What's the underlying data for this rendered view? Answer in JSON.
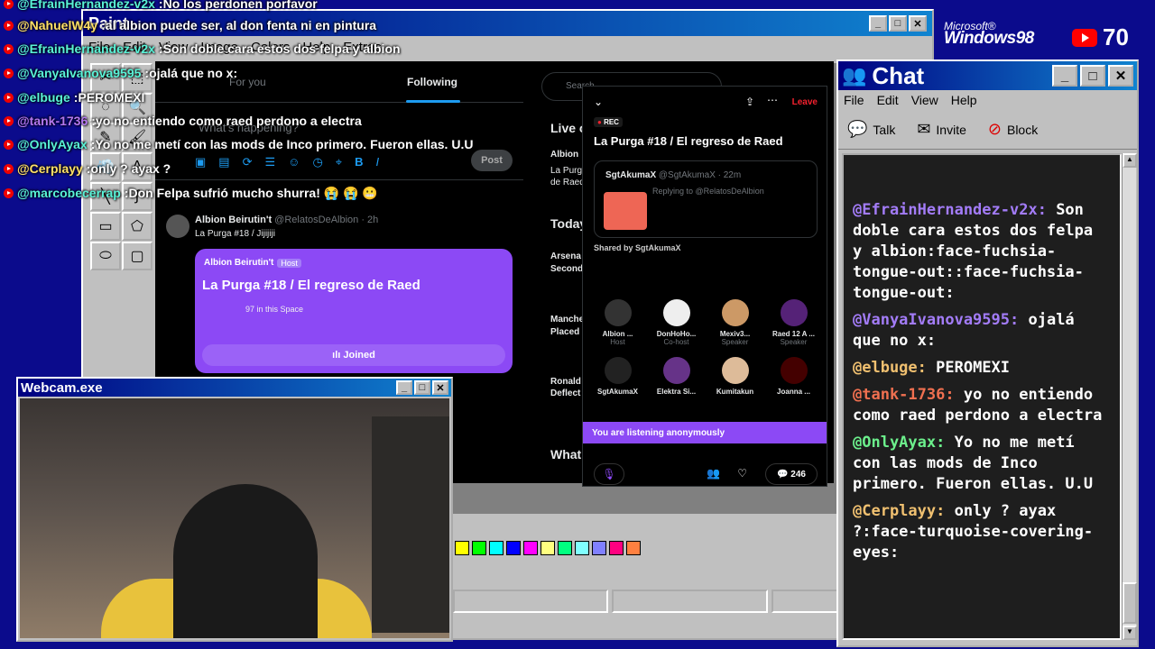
{
  "overlay_chat": [
    {
      "user": "@EfrainHernandez-v2x",
      "user_color": "#59f3d7",
      "message": "No los perdonen porfavor",
      "badge": ""
    },
    {
      "user": "@NahuelW4y",
      "user_color": "#ffe066",
      "message": "al albion puede ser, al don fenta ni en pintura",
      "badge": ""
    },
    {
      "user": "@EfrainHernandez-v2x",
      "user_color": "#59f3d7",
      "message": "Son doble cara estos dos felpa y albion",
      "badge": ""
    },
    {
      "user": "@VanyaIvanova9595",
      "user_color": "#59f3d7",
      "message": "ojalá que no x:",
      "badge": ""
    },
    {
      "user": "@elbuge",
      "user_color": "#59f3d7",
      "message": "PEROMEXI",
      "badge": ""
    },
    {
      "user": "@tank-1736",
      "user_color": "#b478f0",
      "message": "yo no entiendo como raed perdono a electra",
      "badge": ""
    },
    {
      "user": "@OnlyAyax",
      "user_color": "#59f3d7",
      "message": "Yo no me metí con las mods de Inco primero. Fueron ellas. U.U",
      "badge": "🔧"
    },
    {
      "user": "@Cerplayy",
      "user_color": "#ffe066",
      "message": "only ? ayax ?",
      "badge": ""
    },
    {
      "user": "@marcobecerrap",
      "user_color": "#59f3d7",
      "message": "Don Felpa sufrió mucho shurra! 😭 😭 😬",
      "badge": ""
    }
  ],
  "logos": {
    "ms_label": "Microsoft®",
    "windows_label": "Windows98",
    "viewer_count": "70"
  },
  "paint": {
    "title": "Paint",
    "menu": [
      "File",
      "Edit",
      "View",
      "Image",
      "Colors",
      "Help",
      "Extras"
    ],
    "tools": [
      "✂",
      "⬚",
      "◌",
      "🔍",
      "✎",
      "🖌",
      "💨",
      "A",
      "╲",
      "∫",
      "▭",
      "⬠",
      "⬭",
      "▢"
    ],
    "palette": [
      "#ffff00",
      "#00ff00",
      "#00ffff",
      "#0000ff",
      "#ff00ff",
      "#ffff80",
      "#00ff80",
      "#80ffff",
      "#8080ff",
      "#ff0080",
      "#ff8040"
    ]
  },
  "twitter": {
    "tab_for_you": "For you",
    "tab_following": "Following",
    "compose_placeholder": "What's happening?",
    "post_label": "Post",
    "search_placeholder": "Search",
    "tweet_author": "Albion Beirutin't",
    "tweet_handle": "@RelatosDeAlbion · 2h",
    "tweet_text": "La Purga #18 / Jijijiji",
    "space_host": "Albion Beirutin't",
    "host_badge": "Host",
    "space_title": "La Purga #18 / El regreso de Raed",
    "space_count": "97 in this Space",
    "joined_label": "Joined",
    "sidebar_live": "Live o",
    "sidebar_live_sub": "Albion",
    "sidebar_live_sub2": "La Purg",
    "sidebar_live_sub3": "de Raed",
    "sidebar_today": "Today",
    "sidebar_item1": "Arsena",
    "sidebar_item1b": "Second",
    "sidebar_item2": "Manche",
    "sidebar_item2b": "Placed",
    "sidebar_item3": "Ronald",
    "sidebar_item3b": "Deflect",
    "sidebar_whats": "What"
  },
  "spaces_panel": {
    "leave_label": "Leave",
    "rec_label": "REC",
    "title": "La Purga #18 / El regreso de Raed",
    "shared_author": "SgtAkumaX",
    "shared_handle": "@SgtAkumaX · 22m",
    "reply_text": "Replying to @RelatosDeAlbion",
    "shared_by": "Shared by SgtAkumaX",
    "participants": [
      {
        "name": "Albion ...",
        "role": "Host"
      },
      {
        "name": "DonHoHo...",
        "role": "Co-host"
      },
      {
        "name": "Mexiv3...",
        "role": "Speaker"
      },
      {
        "name": "Raed 12 A ...",
        "role": "Speaker"
      },
      {
        "name": "SgtAkumaX",
        "role": ""
      },
      {
        "name": "Elektra Si...",
        "role": ""
      },
      {
        "name": "Kumitakun",
        "role": ""
      },
      {
        "name": "Joanna ...",
        "role": ""
      }
    ],
    "listening_text": "You are listening anonymously",
    "comment_count": "246"
  },
  "webcam": {
    "title": "Webcam.exe"
  },
  "chat_window": {
    "title": "Chat",
    "menu": [
      "File",
      "Edit",
      "View",
      "Help"
    ],
    "toolbar": [
      "Talk",
      "Invite",
      "Block"
    ],
    "entries": [
      {
        "user": "@EfrainHernandez-v2x:",
        "user_color": "#a37cf8",
        "message": "Son doble cara estos dos felpa y albion:face-fuchsia-tongue-out::face-fuchsia-tongue-out:"
      },
      {
        "user": "@VanyaIvanova9595:",
        "user_color": "#a37cf8",
        "message": "ojalá que no x:"
      },
      {
        "user": "@elbuge:",
        "user_color": "#f0c070",
        "message": "PEROMEXI"
      },
      {
        "user": "@tank-1736:",
        "user_color": "#f07050",
        "message": "yo no entiendo como raed perdono a electra"
      },
      {
        "user": "@OnlyAyax:",
        "user_color": "#6cf08c",
        "message": "Yo no me metí con las mods de Inco primero. Fueron ellas. U.U"
      },
      {
        "user": "@Cerplayy:",
        "user_color": "#f0c070",
        "message": "only ? ayax ?:face-turquoise-covering-eyes:"
      }
    ]
  }
}
